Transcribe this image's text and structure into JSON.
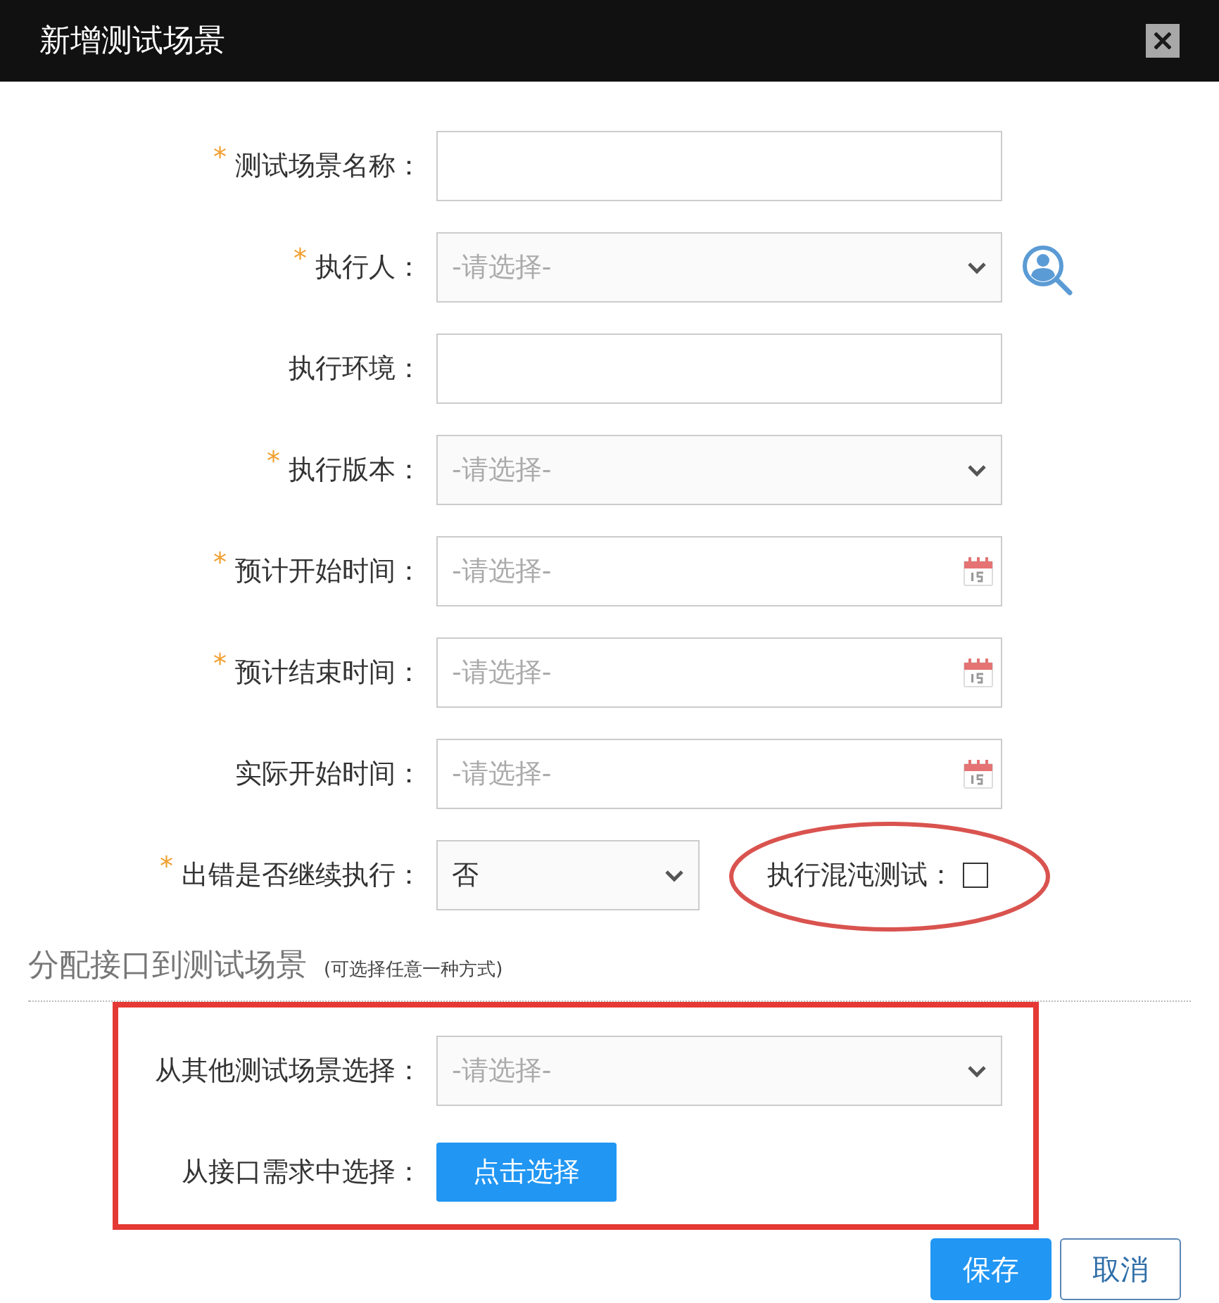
{
  "window": {
    "title": "新增测试场景"
  },
  "fields": [
    {
      "label": "测试场景名称：",
      "asterisk": "*",
      "kind": "text"
    },
    {
      "label": "执行人：",
      "asterisk": "*",
      "kind": "select",
      "placeholder": "-请选择-",
      "lookup": true
    },
    {
      "label": "执行环境：",
      "kind": "text"
    },
    {
      "label": "执行版本：",
      "asterisk": "*",
      "kind": "select",
      "placeholder": "-请选择-"
    },
    {
      "label": "预计开始时间：",
      "asterisk": "*",
      "kind": "date",
      "placeholder": "-请选择-"
    },
    {
      "label": "预计结束时间：",
      "asterisk": "*",
      "kind": "date",
      "placeholder": "-请选择-"
    },
    {
      "label": "实际开始时间：",
      "kind": "date",
      "placeholder": "-请选择-"
    },
    {
      "label": "出错是否继续执行：",
      "asterisk": "*",
      "kind": "select",
      "value": "否",
      "checkbox": {
        "label": "执行混沌测试：",
        "checked": false,
        "circled": true
      }
    }
  ],
  "section": {
    "title": "分配接口到测试场景",
    "note": "(可选择任意一种方式)",
    "boxed": true,
    "rows": [
      {
        "label": "从其他测试场景选择：",
        "kind": "select",
        "placeholder": "-请选择-"
      },
      {
        "label": "从接口需求中选择：",
        "kind": "button",
        "button": "点击选择"
      }
    ]
  },
  "buttons": [
    {
      "label": "保存",
      "kind": "primary"
    },
    {
      "label": "取消",
      "kind": "secondary"
    }
  ]
}
